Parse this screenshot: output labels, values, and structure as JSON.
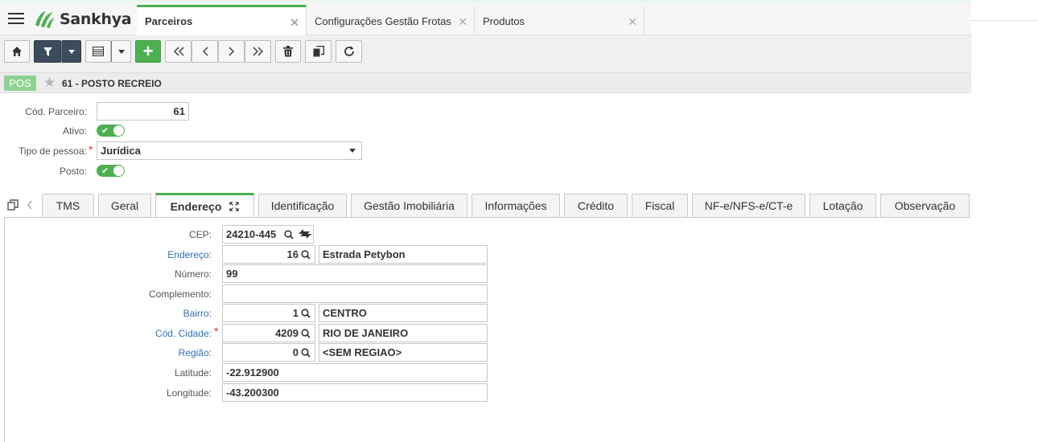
{
  "app": {
    "logo_text": "Sankhya",
    "brand_color": "#4caf50"
  },
  "tabs": [
    {
      "label": "Parceiros",
      "active": true
    },
    {
      "label": "Configurações Gestão Frotas",
      "active": false
    },
    {
      "label": "Produtos",
      "active": false
    }
  ],
  "toolbar": {
    "buttons": [
      "home-icon",
      "filter-icon",
      "grid-icon",
      "add-icon",
      "first-icon",
      "prev-icon",
      "next-icon",
      "last-icon",
      "trash-icon",
      "copy-icon",
      "refresh-icon"
    ],
    "add_label": "+"
  },
  "record": {
    "badge": "POS",
    "title": "61 - POSTO RECREIO"
  },
  "form": {
    "cod_parceiro_label": "Cód. Parceiro:",
    "cod_parceiro_value": "61",
    "ativo_label": "Ativo:",
    "ativo_value": true,
    "tipo_pessoa_label": "Tipo de pessoa:",
    "tipo_pessoa_value": "Jurídica",
    "posto_label": "Posto:",
    "posto_value": true
  },
  "detail_tabs": [
    {
      "label": "TMS"
    },
    {
      "label": "Geral"
    },
    {
      "label": "Endereço",
      "active": true
    },
    {
      "label": "Identificação"
    },
    {
      "label": "Gestão Imobiliária"
    },
    {
      "label": "Informações"
    },
    {
      "label": "Crédito"
    },
    {
      "label": "Fiscal"
    },
    {
      "label": "NF-e/NFS-e/CT-e"
    },
    {
      "label": "Lotação"
    },
    {
      "label": "Observação"
    }
  ],
  "endereco": {
    "cep_label": "CEP:",
    "cep_value": "24210-445",
    "endereco_label": "Endereço:",
    "endereco_code": "16",
    "endereco_desc": "Estrada Petybon",
    "numero_label": "Número:",
    "numero_value": "99",
    "complemento_label": "Complemento:",
    "complemento_value": "",
    "bairro_label": "Bairro:",
    "bairro_code": "1",
    "bairro_desc": "CENTRO",
    "cidade_label": "Cód. Cidade:",
    "cidade_code": "4209",
    "cidade_desc": "RIO DE JANEIRO",
    "regiao_label": "Região:",
    "regiao_code": "0",
    "regiao_desc": "<SEM REGIAO>",
    "latitude_label": "Latitude:",
    "latitude_value": "-22.912900",
    "longitude_label": "Longitude:",
    "longitude_value": "-43.200300"
  }
}
